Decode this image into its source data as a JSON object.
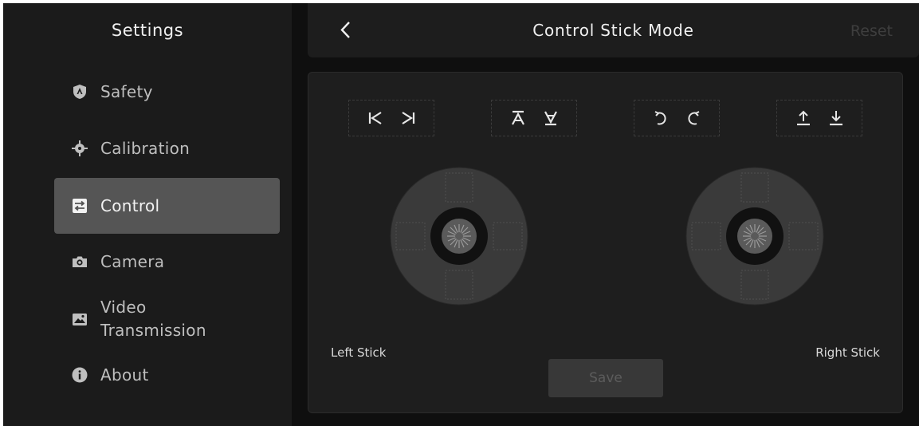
{
  "sidebar": {
    "title": "Settings",
    "items": [
      {
        "label": "Safety",
        "icon": "shield-icon",
        "active": false
      },
      {
        "label": "Calibration",
        "icon": "calibration-icon",
        "active": false
      },
      {
        "label": "Control",
        "icon": "control-icon",
        "active": true
      },
      {
        "label": "Camera",
        "icon": "camera-icon",
        "active": false
      },
      {
        "label": "Video\nTransmission",
        "icon": "video-transmission-icon",
        "active": false
      },
      {
        "label": "About",
        "icon": "info-icon",
        "active": false
      }
    ]
  },
  "header": {
    "title": "Control Stick Mode",
    "back_icon": "chevron-left-icon",
    "reset_label": "Reset"
  },
  "panel": {
    "mode_groups": [
      {
        "icons": [
          "yaw-left-icon",
          "yaw-right-icon"
        ]
      },
      {
        "icons": [
          "pitch-forward-icon",
          "pitch-back-icon"
        ]
      },
      {
        "icons": [
          "rotate-left-icon",
          "rotate-right-icon"
        ]
      },
      {
        "icons": [
          "ascend-icon",
          "descend-icon"
        ]
      }
    ],
    "left_stick_label": "Left Stick",
    "right_stick_label": "Right Stick",
    "save_label": "Save"
  },
  "colors": {
    "background": "#0f0f0f",
    "sidebar": "#1b1b1b",
    "active_item": "#555555",
    "panel": "#1e1e1e",
    "disabled_text": "#3e3e3e"
  }
}
